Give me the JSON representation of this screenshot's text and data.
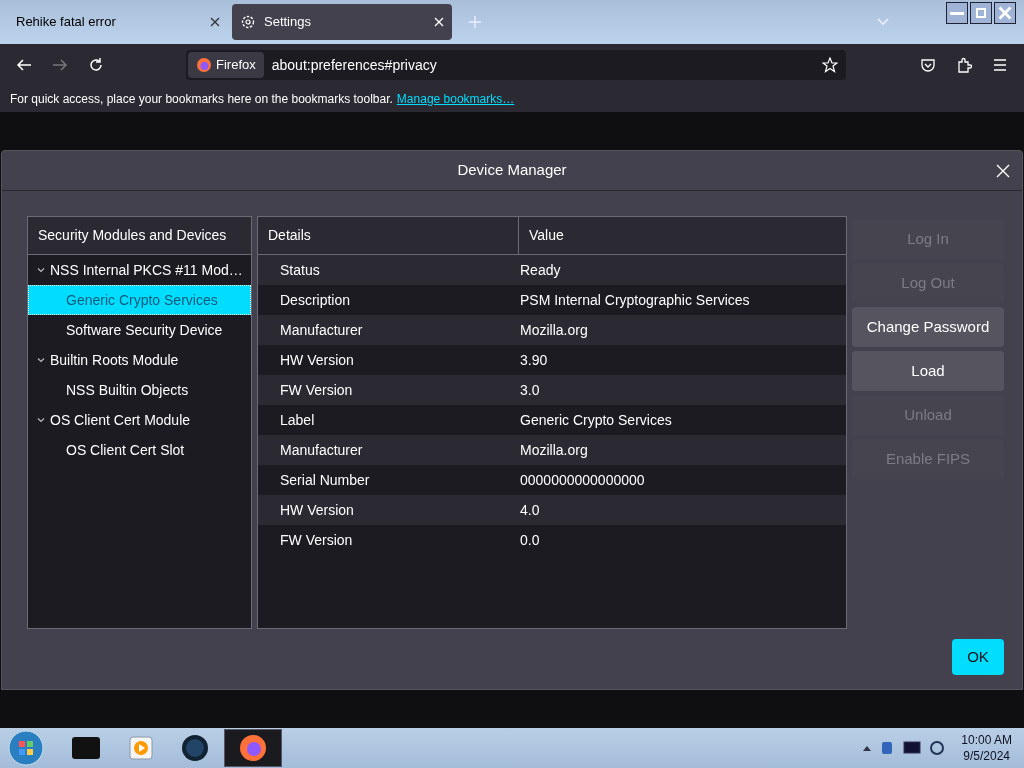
{
  "tabs": [
    {
      "title": "Rehike fatal error",
      "icon": false,
      "selected": false
    },
    {
      "title": "Settings",
      "icon": true,
      "selected": true
    }
  ],
  "nav": {
    "identity": "Firefox",
    "url": "about:preferences#privacy"
  },
  "bookmarks_bar": {
    "text": "For quick access, place your bookmarks here on the bookmarks toolbar.",
    "link": "Manage bookmarks…"
  },
  "dialog": {
    "title": "Device Manager",
    "tree": {
      "heading": "Security Modules and Devices",
      "items": [
        {
          "label": "NSS Internal PKCS #11 Mod…",
          "expanded": true,
          "children": [
            {
              "label": "Generic Crypto Services",
              "selected": true
            },
            {
              "label": "Software Security Device",
              "selected": false
            }
          ]
        },
        {
          "label": "Builtin Roots Module",
          "expanded": true,
          "children": [
            {
              "label": "NSS Builtin Objects",
              "selected": false
            }
          ]
        },
        {
          "label": "OS Client Cert Module",
          "expanded": true,
          "children": [
            {
              "label": "OS Client Cert Slot",
              "selected": false
            }
          ]
        }
      ]
    },
    "table": {
      "columns": [
        "Details",
        "Value"
      ],
      "rows": [
        [
          "Status",
          "Ready"
        ],
        [
          "Description",
          "PSM Internal Cryptographic Services"
        ],
        [
          "Manufacturer",
          "Mozilla.org"
        ],
        [
          "HW Version",
          "3.90"
        ],
        [
          "FW Version",
          "3.0"
        ],
        [
          "Label",
          "Generic Crypto Services"
        ],
        [
          "Manufacturer",
          "Mozilla.org"
        ],
        [
          "Serial Number",
          "0000000000000000"
        ],
        [
          "HW Version",
          "4.0"
        ],
        [
          "FW Version",
          "0.0"
        ]
      ]
    },
    "buttons": [
      {
        "label": "Log In",
        "disabled": true
      },
      {
        "label": "Log Out",
        "disabled": true
      },
      {
        "label": "Change Password",
        "disabled": false
      },
      {
        "label": "Load",
        "disabled": false
      },
      {
        "label": "Unload",
        "disabled": true
      },
      {
        "label": "Enable FIPS",
        "disabled": true
      }
    ],
    "ok": "OK"
  },
  "taskbar": {
    "time": "10:00 AM",
    "date": "9/5/2024"
  }
}
